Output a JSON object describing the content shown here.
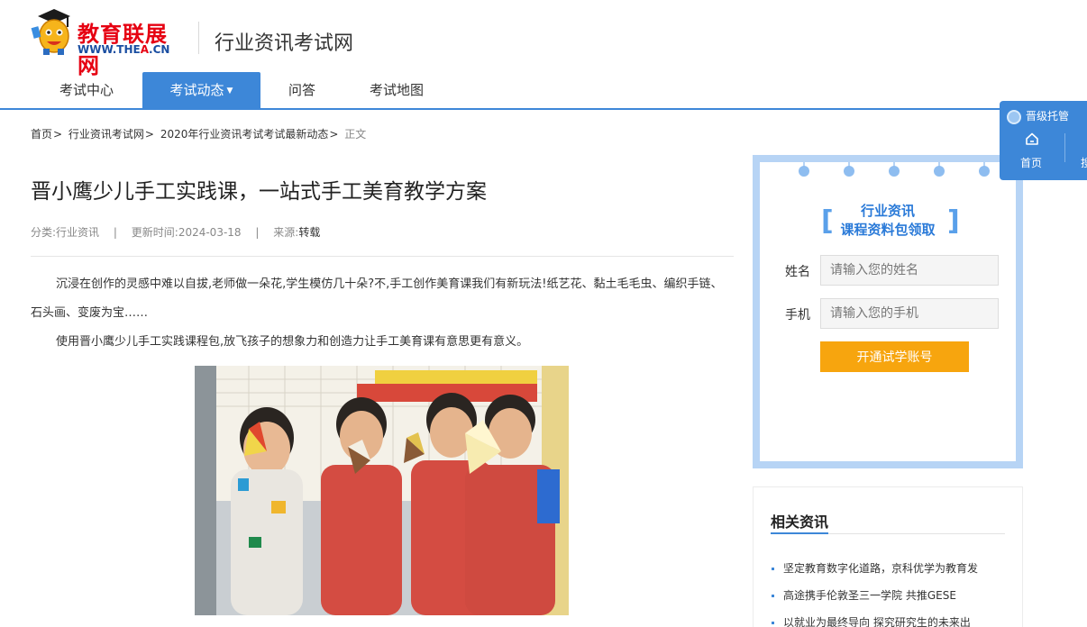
{
  "header": {
    "logo_text": "教育联展网",
    "logo_url_prefix": "WWW.THE",
    "logo_url_highlight": "A",
    "logo_url_suffix": ".CN",
    "site_title": "行业资讯考试网"
  },
  "nav": {
    "items": [
      {
        "label": "考试中心"
      },
      {
        "label": "考试动态",
        "caret": "▼",
        "active": true
      },
      {
        "label": "问答"
      },
      {
        "label": "考试地图"
      }
    ]
  },
  "breadcrumb": {
    "items": [
      "首页",
      "行业资讯考试网",
      "2020年行业资讯考试考试最新动态"
    ],
    "separator": ">",
    "current": "正文"
  },
  "article": {
    "title": "晋小鹰少儿手工实践课，一站式手工美育教学方案",
    "meta": {
      "category_label": "分类:",
      "category": "行业资讯",
      "updated_label": "更新时间:",
      "updated": "2024-03-18",
      "source_label": "来源:",
      "source": "转载",
      "divider": "|"
    },
    "paragraph_1": "沉浸在创作的灵感中难以自拔,老师做一朵花,学生模仿几十朵?不,手工创作美育课我们有新玩法!纸艺花、黏土毛毛虫、编织手链、石头画、变废为宝……",
    "paragraph_2": "使用晋小鹰少儿手工实践课程包,放飞孩子的想象力和创造力让手工美育课有意思更有意义。"
  },
  "form": {
    "heading_line1": "行业资讯",
    "heading_line2": "课程资料包领取",
    "bracket_left": "[",
    "bracket_right": "]",
    "name_label": "姓名",
    "name_placeholder": "请输入您的姓名",
    "phone_label": "手机",
    "phone_placeholder": "请输入您的手机",
    "submit_label": "开通试学账号"
  },
  "related": {
    "title": "相关资讯",
    "items": [
      "坚定教育数字化道路，京科优学为教育发",
      "高途携手伦敦圣三一学院 共推GESE",
      "以就业为最终导向 探究研究生的未来出"
    ]
  },
  "float_panel": {
    "title": "晋级托管",
    "home_label": "首页",
    "more_label": "搜"
  },
  "colors": {
    "brand_blue": "#3d87d8",
    "logo_red": "#e60012",
    "submit_orange": "#f7a50e",
    "form_border": "#b7d4f5"
  }
}
